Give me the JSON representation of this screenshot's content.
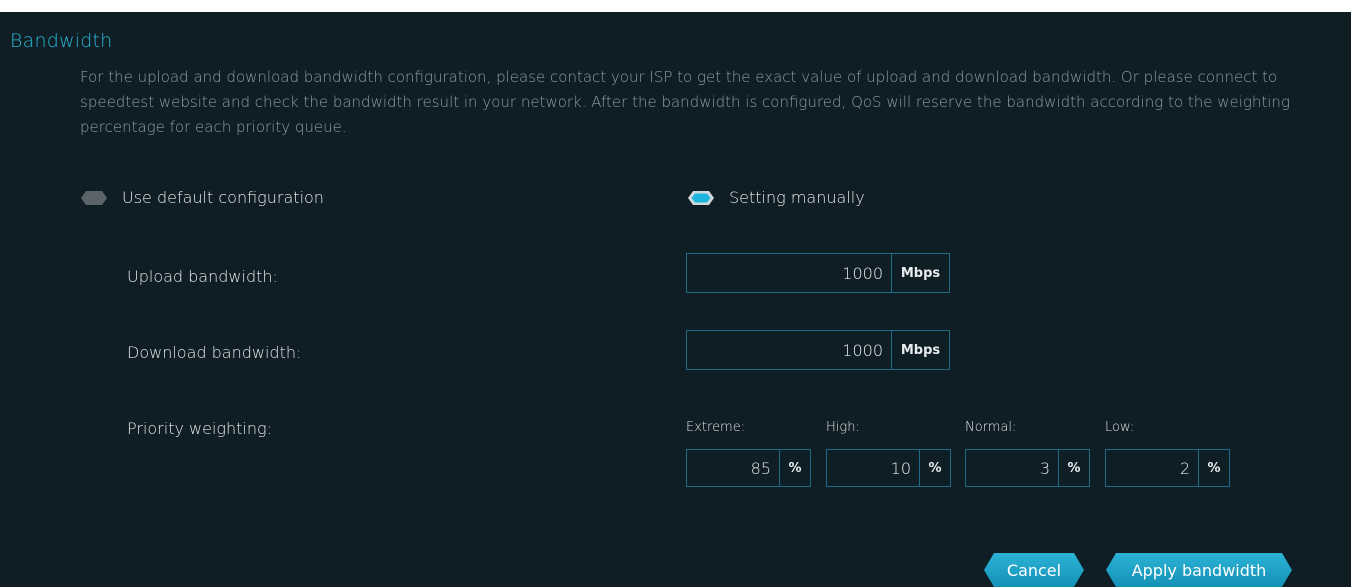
{
  "section": {
    "title": "Bandwidth",
    "description": "For the upload and download bandwidth configuration, please contact your ISP to get the exact value of upload and download bandwidth. Or please connect to speedtest website and check the bandwidth result in your network. After the bandwidth is configured, QoS will reserve the bandwidth according to the weighting percentage for each priority queue."
  },
  "mode": {
    "default_label": "Use default configuration",
    "manual_label": "Setting manually",
    "selected": "manual"
  },
  "upload": {
    "label": "Upload bandwidth:",
    "value": "1000",
    "unit": "Mbps"
  },
  "download": {
    "label": "Download bandwidth:",
    "value": "1000",
    "unit": "Mbps"
  },
  "priority": {
    "label": "Priority weighting:",
    "items": [
      {
        "label": "Extreme:",
        "value": "85",
        "unit": "%"
      },
      {
        "label": "High:",
        "value": "10",
        "unit": "%"
      },
      {
        "label": "Normal:",
        "value": "3",
        "unit": "%"
      },
      {
        "label": "Low:",
        "value": "2",
        "unit": "%"
      }
    ]
  },
  "buttons": {
    "cancel": "Cancel",
    "apply": "Apply bandwidth"
  },
  "colors": {
    "accent": "#29b8d9",
    "background": "#0f1d24",
    "border": "#1f6a85",
    "radio_off": "#5b6468"
  }
}
